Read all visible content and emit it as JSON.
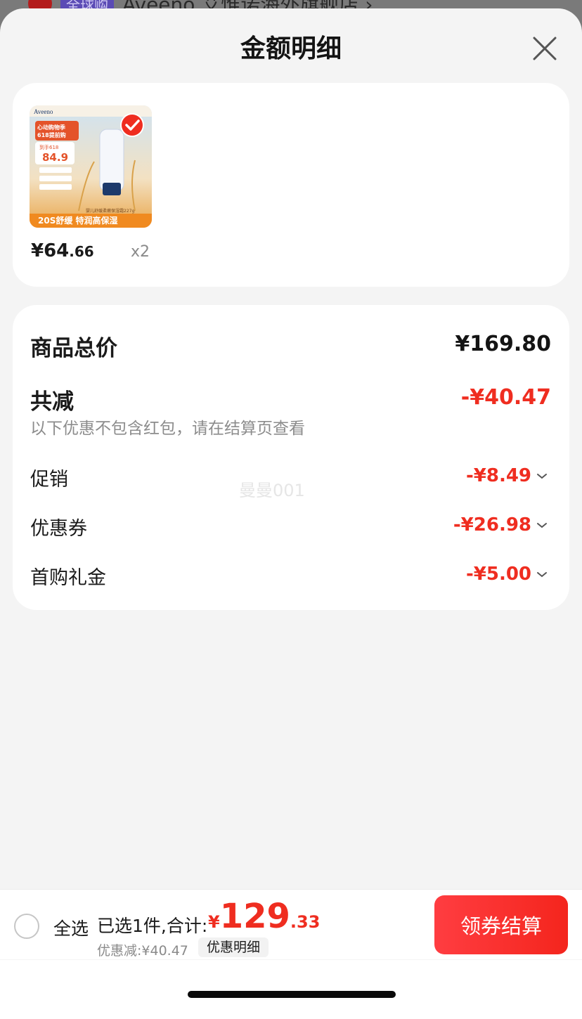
{
  "background": {
    "store_tag": "全球购",
    "store_name": "Aveeno 艾惟诺海外旗舰店 ›"
  },
  "sheet": {
    "title": "金额明细"
  },
  "product": {
    "price_int": "¥64",
    "price_dec": ".66",
    "qty": "x2",
    "thumb_texts": {
      "brand": "Aveeno",
      "promo": "心动购物季",
      "promo2": "618提前购",
      "price_label": "到手618",
      "price": "84.9",
      "banner": "20S舒缓 特润高保湿",
      "product_line": "婴儿舒缓柔嫩保湿霜227g"
    }
  },
  "summary": {
    "total_label": "商品总价",
    "total_value": "¥169.80",
    "reduce_label": "共减",
    "reduce_value": "-¥40.47",
    "note": "以下优惠不包含红包，请在结算页查看",
    "watermark": "曼曼001",
    "items": [
      {
        "label": "促销",
        "value": "-¥8.49"
      },
      {
        "label": "优惠券",
        "value": "-¥26.98"
      },
      {
        "label": "首购礼金",
        "value": "-¥5.00"
      }
    ]
  },
  "bottom_bar": {
    "select_all": "全选",
    "selected_text": "已选1件,合计:",
    "total_currency": "¥",
    "total_int": "129",
    "total_dec": ".33",
    "discount_note": "优惠减:¥40.47",
    "detail_chip": "优惠明细",
    "checkout": "领券结算"
  },
  "colors": {
    "accent_red": "#ef2d20",
    "sheet_bg": "#f4f4f4"
  }
}
